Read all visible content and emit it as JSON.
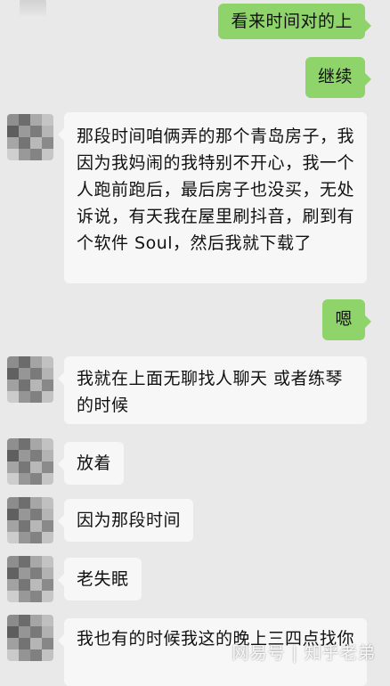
{
  "colors": {
    "background": "#e9e9e9",
    "sent_bubble": "#8fd46a",
    "received_bubble": "#f7f7f7"
  },
  "messages": [
    {
      "side": "right",
      "text": "看来时间对的上"
    },
    {
      "side": "right",
      "text": "继续"
    },
    {
      "side": "left",
      "text": "那段时间咱俩弄的那个青岛房子，我因为我妈闹的我特别不开心，我一个人跑前跑后，最后房子也没买，无处诉说，有天我在屋里刷抖音，刷到有个软件 Soul，然后我就下载了"
    },
    {
      "side": "right",
      "text": "嗯"
    },
    {
      "side": "left",
      "text": "我就在上面无聊找人聊天 或者练琴的时候"
    },
    {
      "side": "left",
      "text": "放着"
    },
    {
      "side": "left",
      "text": "因为那段时间"
    },
    {
      "side": "left",
      "text": "老失眠"
    },
    {
      "side": "left",
      "text": "我也有的时候我这的晚上三四点找你"
    }
  ],
  "watermark": "网易号 | 知乎老弟"
}
